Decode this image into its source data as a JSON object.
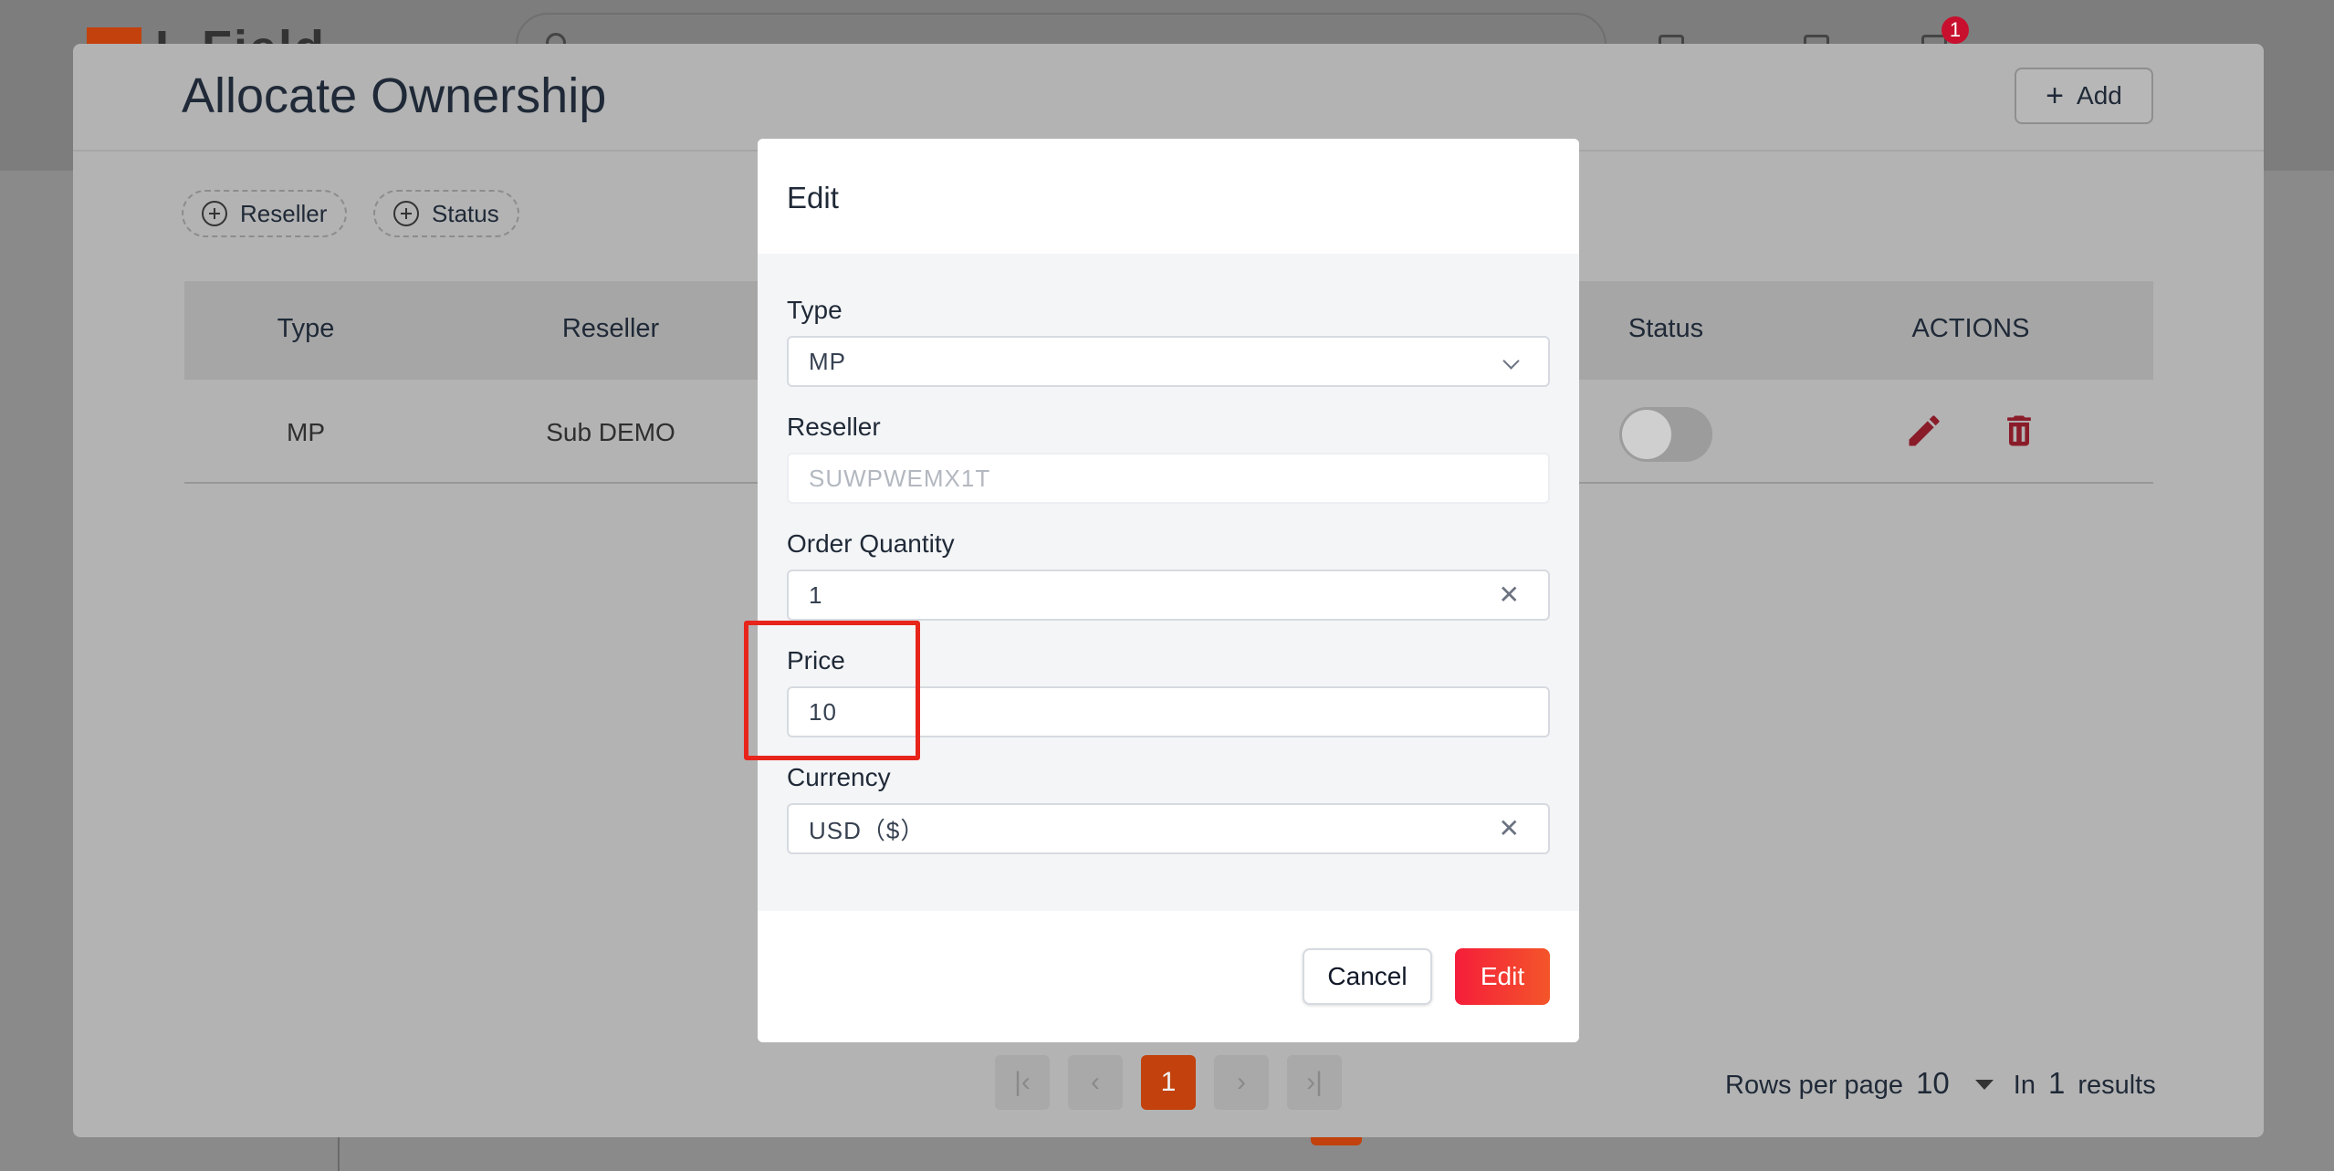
{
  "app": {
    "logo_text": "L  Field",
    "notification_count": "1"
  },
  "page": {
    "title": "Allocate Ownership",
    "add_label": "Add",
    "filters": [
      {
        "label": "Reseller"
      },
      {
        "label": "Status"
      }
    ]
  },
  "table": {
    "headers": {
      "type": "Type",
      "reseller": "Reseller",
      "status": "Status",
      "actions": "ACTIONS"
    },
    "rows": [
      {
        "type": "MP",
        "reseller": "Sub DEMO",
        "status_on": false
      }
    ]
  },
  "pagination": {
    "current_page": "1",
    "rows_per_page_label": "Rows per page",
    "rows_per_page": "10",
    "in_label": "In",
    "total": "1",
    "results_label": "results"
  },
  "modal": {
    "title": "Edit",
    "type_label": "Type",
    "type_value": "MP",
    "reseller_label": "Reseller",
    "reseller_value": "SUWPWEMX1T",
    "order_quantity_label": "Order Quantity",
    "order_quantity_value": "1",
    "price_label": "Price",
    "price_value": "10",
    "currency_label": "Currency",
    "currency_value": "USD（$）",
    "cancel_label": "Cancel",
    "edit_label": "Edit"
  },
  "colors": {
    "accent": "#f51d3a",
    "highlight": "#e8251b",
    "action_icons": "#c8102e"
  }
}
